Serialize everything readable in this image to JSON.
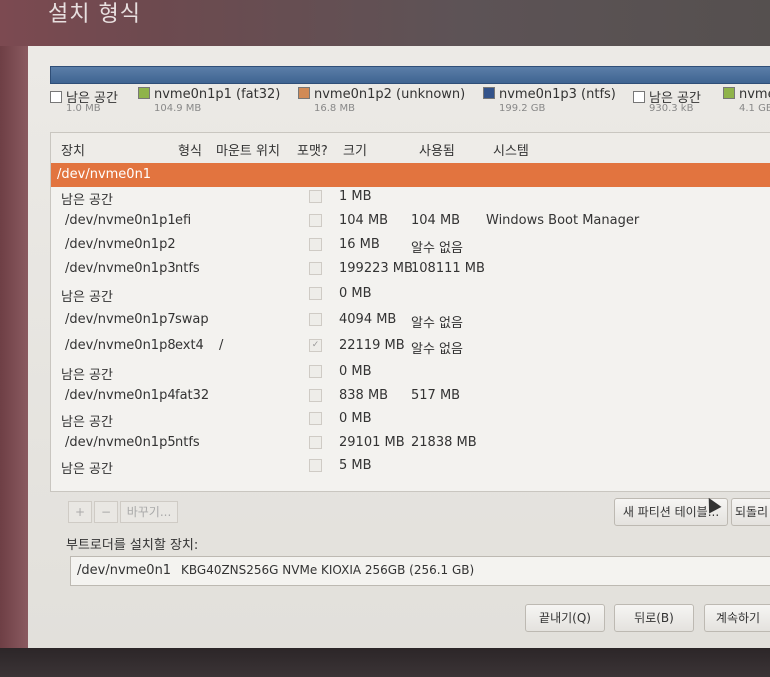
{
  "window": {
    "title": "설치 형식"
  },
  "partition_legend": [
    {
      "name": "남은 공간",
      "size": "1.0 MB",
      "color": "#ffffff"
    },
    {
      "name": "nvme0n1p1 (fat32)",
      "size": "104.9 MB",
      "color": "#8fb34a"
    },
    {
      "name": "nvme0n1p2 (unknown)",
      "size": "16.8 MB",
      "color": "#d08a56"
    },
    {
      "name": "nvme0n1p3 (ntfs)",
      "size": "199.2 GB",
      "color": "#34538a"
    },
    {
      "name": "남은 공간",
      "size": "930.3 kB",
      "color": "#ffffff"
    },
    {
      "name": "nvme",
      "size": "4.1 GB",
      "color": "#8fb34a"
    }
  ],
  "table": {
    "columns": [
      "장치",
      "형식",
      "마운트 위치",
      "포맷?",
      "크기",
      "사용됨",
      "시스템"
    ],
    "selected_row": "/dev/nvme0n1",
    "rows": [
      {
        "device": "남은 공간",
        "type": "",
        "mount": "",
        "format": false,
        "size": "1 MB",
        "used": "",
        "system": ""
      },
      {
        "device": "/dev/nvme0n1p1",
        "type": "efi",
        "mount": "",
        "format": false,
        "size": "104 MB",
        "used": "104 MB",
        "system": "Windows Boot Manager"
      },
      {
        "device": "/dev/nvme0n1p2",
        "type": "",
        "mount": "",
        "format": false,
        "size": "16 MB",
        "used": "알수 없음",
        "system": ""
      },
      {
        "device": "/dev/nvme0n1p3",
        "type": "ntfs",
        "mount": "",
        "format": false,
        "size": "199223 MB",
        "used": "108111 MB",
        "system": ""
      },
      {
        "device": "남은 공간",
        "type": "",
        "mount": "",
        "format": false,
        "size": "0 MB",
        "used": "",
        "system": ""
      },
      {
        "device": "/dev/nvme0n1p7",
        "type": "swap",
        "mount": "",
        "format": false,
        "size": "4094 MB",
        "used": "알수 없음",
        "system": ""
      },
      {
        "device": "/dev/nvme0n1p8",
        "type": "ext4",
        "mount": "/",
        "format": true,
        "size": "22119 MB",
        "used": "알수 없음",
        "system": ""
      },
      {
        "device": "남은 공간",
        "type": "",
        "mount": "",
        "format": false,
        "size": "0 MB",
        "used": "",
        "system": ""
      },
      {
        "device": "/dev/nvme0n1p4",
        "type": "fat32",
        "mount": "",
        "format": false,
        "size": "838 MB",
        "used": "517 MB",
        "system": ""
      },
      {
        "device": "남은 공간",
        "type": "",
        "mount": "",
        "format": false,
        "size": "0 MB",
        "used": "",
        "system": ""
      },
      {
        "device": "/dev/nvme0n1p5",
        "type": "ntfs",
        "mount": "",
        "format": false,
        "size": "29101 MB",
        "used": "21838 MB",
        "system": ""
      },
      {
        "device": "남은 공간",
        "type": "",
        "mount": "",
        "format": false,
        "size": "5 MB",
        "used": "",
        "system": ""
      }
    ]
  },
  "toolbar": {
    "add": "+",
    "remove": "−",
    "change": "바꾸기...",
    "new_table": "새 파티션 테이블...",
    "revert": "되돌리"
  },
  "bootloader": {
    "label": "부트로더를 설치할 장치:",
    "device": "/dev/nvme0n1",
    "model": "KBG40ZNS256G NVMe KIOXIA 256GB (256.1 GB)"
  },
  "footer": {
    "quit": "끝내기(Q)",
    "back": "뒤로(B)",
    "continue": "계속하기"
  }
}
